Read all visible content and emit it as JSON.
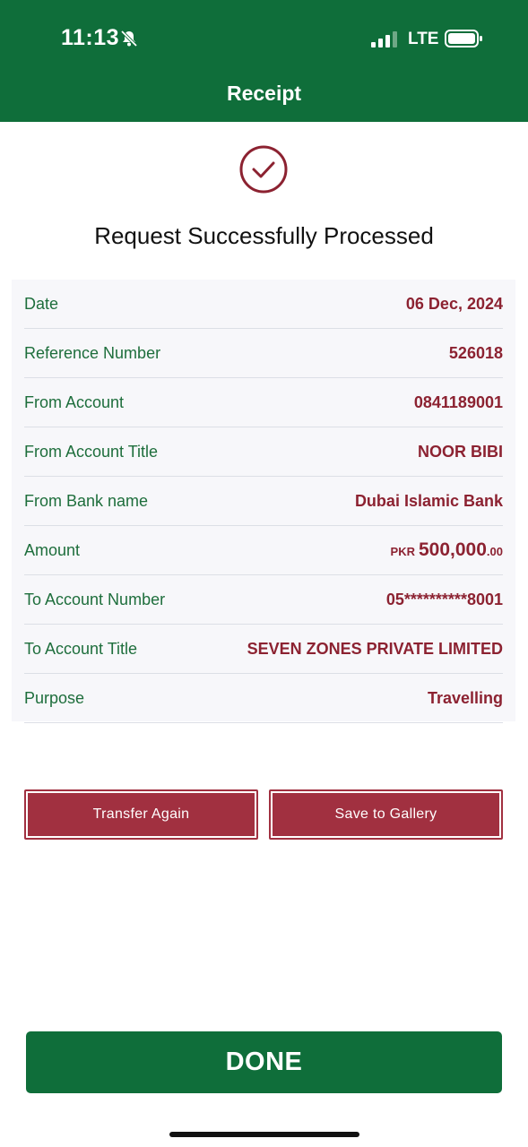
{
  "status_bar": {
    "time": "11:13",
    "network": "LTE"
  },
  "header": {
    "title": "Receipt"
  },
  "heading": "Request Successfully Processed",
  "details": [
    {
      "label": "Date",
      "value": "06 Dec, 2024"
    },
    {
      "label": "Reference Number",
      "value": "526018"
    },
    {
      "label": "From Account",
      "value": "0841189001"
    },
    {
      "label": "From Account Title",
      "value": "NOOR BIBI"
    },
    {
      "label": "From Bank name",
      "value": "Dubai Islamic Bank"
    },
    {
      "label": "Amount",
      "currency": "PKR",
      "amount_main": "500,000",
      "amount_decimal": ".00"
    },
    {
      "label": "To Account Number",
      "value": "05**********8001"
    },
    {
      "label": "To Account Title",
      "value": "SEVEN ZONES PRIVATE LIMITED"
    },
    {
      "label": "Purpose",
      "value": "Travelling"
    }
  ],
  "buttons": {
    "transfer_again": "Transfer Again",
    "save_to_gallery": "Save to Gallery",
    "done": "DONE"
  },
  "colors": {
    "brand_green": "#0f6e3a",
    "accent_red": "#a13040",
    "value_red": "#8c2231",
    "label_green": "#1e6e3c"
  },
  "icons": [
    "bell-slash-icon",
    "signal-icon",
    "battery-icon",
    "check-circle-icon"
  ]
}
